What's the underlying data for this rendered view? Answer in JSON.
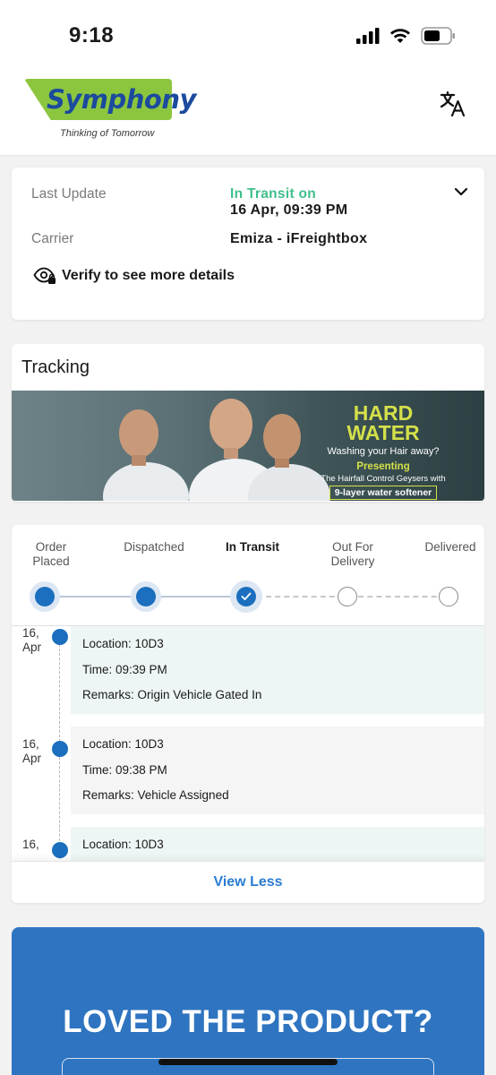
{
  "status_bar": {
    "time": "9:18"
  },
  "header": {
    "brand_name": "Symphony",
    "tagline": "Thinking of Tomorrow",
    "icons": {
      "translate": "translate-icon"
    },
    "colors": {
      "brand_green": "#8cc63f",
      "brand_blue": "#1b4a9e"
    }
  },
  "details": {
    "last_update_label": "Last Update",
    "status_text": "In Transit on",
    "last_update_value": "16 Apr, 09:39 PM",
    "carrier_label": "Carrier",
    "carrier_value": "Emiza - iFreightbox",
    "verify_text": "Verify to see more details",
    "status_color": "#3fbf8a"
  },
  "tracking": {
    "title": "Tracking",
    "banner": {
      "headline_1": "HARD",
      "headline_2": "WATER",
      "subline": "Washing your Hair away?",
      "presenting": "Presenting",
      "line_1": "The Hairfall Control Geysers with",
      "line_2": "9-layer water softener"
    }
  },
  "progress": {
    "steps": [
      {
        "label_1": "Order",
        "label_2": "Placed",
        "state": "done"
      },
      {
        "label_1": "Dispatched",
        "label_2": "",
        "state": "done"
      },
      {
        "label_1": "In Transit",
        "label_2": "",
        "state": "current"
      },
      {
        "label_1": "Out For",
        "label_2": "Delivery",
        "state": "pending"
      },
      {
        "label_1": "Delivered",
        "label_2": "",
        "state": "pending"
      }
    ],
    "accent": "#1b6fbe"
  },
  "events": [
    {
      "date_1": "16,",
      "date_2": "Apr",
      "location": "Location: 10D3",
      "time": "Time: 09:39 PM",
      "remarks": "Remarks: Origin Vehicle Gated In"
    },
    {
      "date_1": "16,",
      "date_2": "Apr",
      "location": "Location: 10D3",
      "time": "Time: 09:38 PM",
      "remarks": "Remarks: Vehicle Assigned"
    },
    {
      "date_1": "16,",
      "date_2": "",
      "location": "Location: 10D3",
      "time": "",
      "remarks": ""
    }
  ],
  "view_less": "View Less",
  "promo": {
    "title": "LOVED THE PRODUCT?",
    "color": "#2f74c0"
  }
}
